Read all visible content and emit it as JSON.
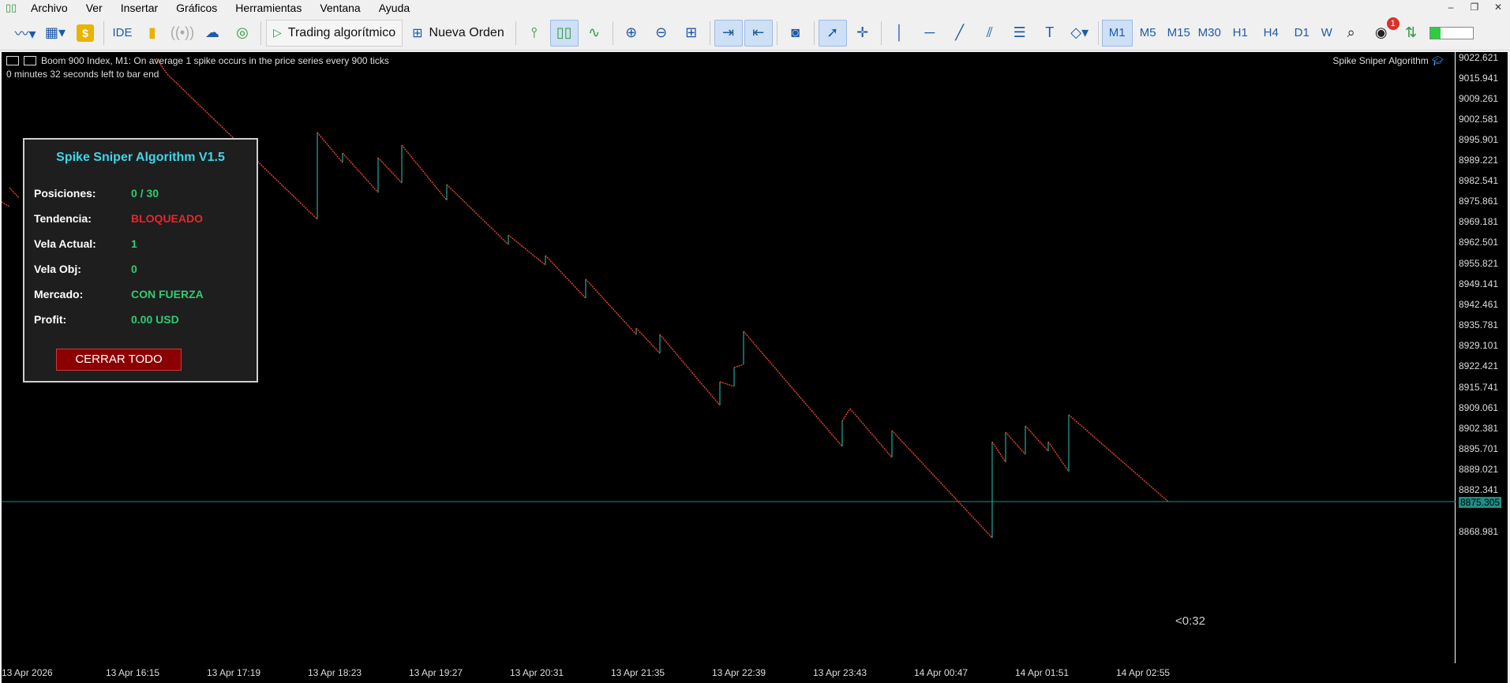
{
  "menu": {
    "items": [
      "Archivo",
      "Ver",
      "Insertar",
      "Gráficos",
      "Herramientas",
      "Ventana",
      "Ayuda"
    ]
  },
  "toolbar": {
    "ide_label": "IDE",
    "algo_label": "Trading algorítmico",
    "order_label": "Nueva Orden",
    "timeframes": [
      "M1",
      "M5",
      "M15",
      "M30",
      "H1",
      "H4",
      "D1",
      "W"
    ],
    "active_timeframe": "M1",
    "notification_count": "1",
    "connection_level": 0.25
  },
  "chart": {
    "header": "Boom 900 Index, M1:  On average 1 spike occurs in the price series every 900 ticks",
    "countdown_top": "0 minutes 32 seconds left to bar end",
    "ea_name": "Spike Sniper Algorithm",
    "bar_end_label": "<0:32",
    "current_price": "8875.305",
    "price_labels": [
      "9022.621",
      "9015.941",
      "9009.261",
      "9002.581",
      "8995.901",
      "8989.221",
      "8982.541",
      "8975.861",
      "8969.181",
      "8962.501",
      "8955.821",
      "8949.141",
      "8942.461",
      "8935.781",
      "8929.101",
      "8922.421",
      "8915.741",
      "8909.061",
      "8902.381",
      "8895.701",
      "8889.021",
      "8882.341",
      "8868.981"
    ],
    "time_labels": [
      "13 Apr 2026",
      "13 Apr 16:15",
      "13 Apr 17:19",
      "13 Apr 18:23",
      "13 Apr 19:27",
      "13 Apr 20:31",
      "13 Apr 21:35",
      "13 Apr 22:39",
      "13 Apr 23:43",
      "14 Apr 00:47",
      "14 Apr 01:51",
      "14 Apr 02:55"
    ],
    "colors": {
      "bear": "#e8472b",
      "bull": "#26a69a",
      "price_line": "#1d8f87"
    }
  },
  "panel": {
    "title": "Spike Sniper Algorithm V1.5",
    "rows": [
      {
        "label": "Posiciones:",
        "value": "0 / 30"
      },
      {
        "label": "Tendencia:",
        "value": "BLOQUEADO"
      },
      {
        "label": "Vela Actual:",
        "value": "1"
      },
      {
        "label": "Vela Obj:",
        "value": "0"
      },
      {
        "label": "Mercado:",
        "value": "CON FUERZA"
      },
      {
        "label": "Profit:",
        "value": "0.00 USD"
      }
    ],
    "close_button": "CERRAR TODO"
  }
}
